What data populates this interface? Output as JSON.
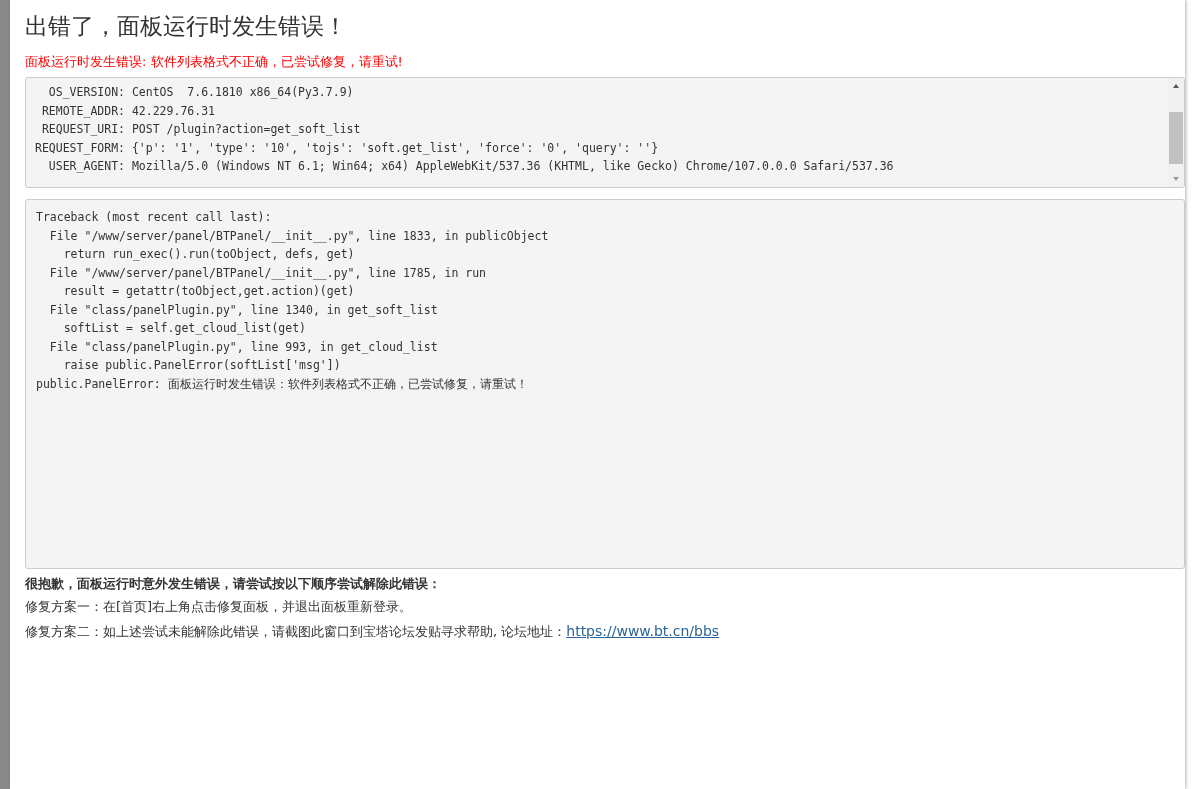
{
  "title": "出错了，面板运行时发生错误！",
  "error_message": "面板运行时发生错误: 软件列表格式不正确，已尝试修复，请重试!",
  "environment_lines": [
    "  OS_VERSION: CentOS  7.6.1810 x86_64(Py3.7.9)",
    " REMOTE_ADDR: 42.229.76.31",
    " REQUEST_URI: POST /plugin?action=get_soft_list",
    "REQUEST_FORM: {'p': '1', 'type': '10', 'tojs': 'soft.get_list', 'force': '0', 'query': ''}",
    "  USER_AGENT: Mozilla/5.0 (Windows NT 6.1; Win64; x64) AppleWebKit/537.36 (KHTML, like Gecko) Chrome/107.0.0.0 Safari/537.36"
  ],
  "traceback_lines": [
    "Traceback (most recent call last):",
    "  File \"/www/server/panel/BTPanel/__init__.py\", line 1833, in publicObject",
    "    return run_exec().run(toObject, defs, get)",
    "  File \"/www/server/panel/BTPanel/__init__.py\", line 1785, in run",
    "    result = getattr(toObject,get.action)(get)",
    "  File \"class/panelPlugin.py\", line 1340, in get_soft_list",
    "    softList = self.get_cloud_list(get)",
    "  File \"class/panelPlugin.py\", line 993, in get_cloud_list",
    "    raise public.PanelError(softList['msg'])",
    "public.PanelError: 面板运行时发生错误：软件列表格式不正确，已尝试修复，请重试！"
  ],
  "help": {
    "heading": "很抱歉，面板运行时意外发生错误，请尝试按以下顺序尝试解除此错误：",
    "steps": [
      {
        "text": "修复方案一：在[首页]右上角点击修复面板，并退出面板重新登录。"
      },
      {
        "text": "修复方案二：如上述尝试未能解除此错误，请截图此窗口到宝塔论坛发贴寻求帮助, 论坛地址：",
        "link": "https://www.bt.cn/bbs"
      }
    ]
  }
}
